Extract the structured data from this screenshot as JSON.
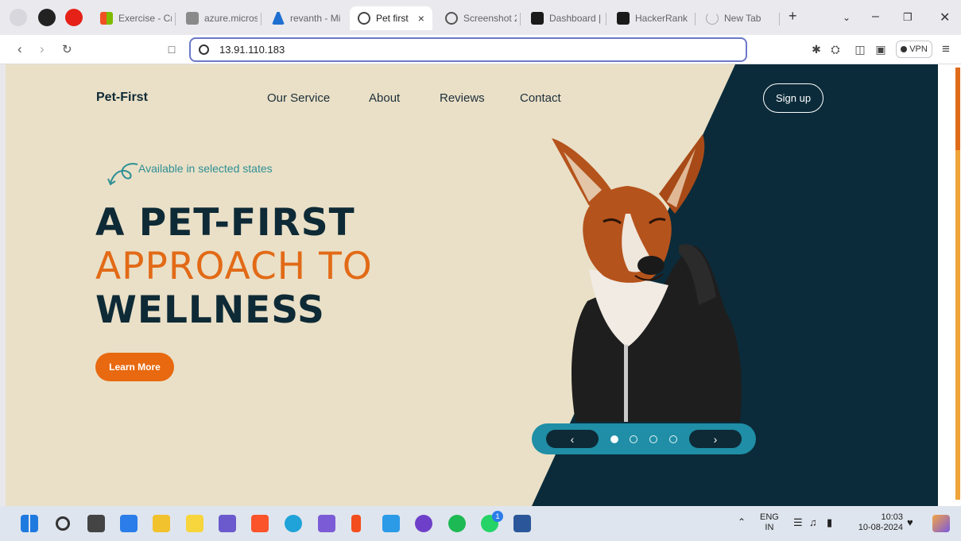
{
  "browser": {
    "tabs": [
      {
        "label": "Exercise - Cr",
        "active": false
      },
      {
        "label": "azure.micros",
        "active": false
      },
      {
        "label": "revanth - Mi",
        "active": false
      },
      {
        "label": "Pet first",
        "active": true
      },
      {
        "label": "Screenshot 2",
        "active": false
      },
      {
        "label": "Dashboard |",
        "active": false
      },
      {
        "label": "HackerRank",
        "active": false
      },
      {
        "label": "New Tab",
        "active": false
      }
    ],
    "new_tab_label": "+",
    "close_tab_glyph": "×",
    "url": "13.91.110.183",
    "vpn_label": "VPN"
  },
  "page": {
    "brand": "Pet-First",
    "nav": [
      "Our Service",
      "About",
      "Reviews",
      "Contact"
    ],
    "signup_label": "Sign up",
    "tagline": "Available in selected states",
    "headline": {
      "line1": "A PET-FIRST",
      "line2": "APPROACH TO",
      "line3": "WELLNESS"
    },
    "cta_label": "Learn More",
    "carousel": {
      "prev": "‹",
      "next": "›",
      "slides": 4,
      "active_slide": 1
    },
    "colors": {
      "dark": "#0e2a36",
      "accent_orange": "#e8690f",
      "teal": "#1f8ea6",
      "cream": "#eae0c7"
    }
  },
  "taskbar": {
    "language": "ENG",
    "region": "IN",
    "time": "10:03",
    "date": "10-08-2024",
    "whatsapp_badge": "1"
  }
}
